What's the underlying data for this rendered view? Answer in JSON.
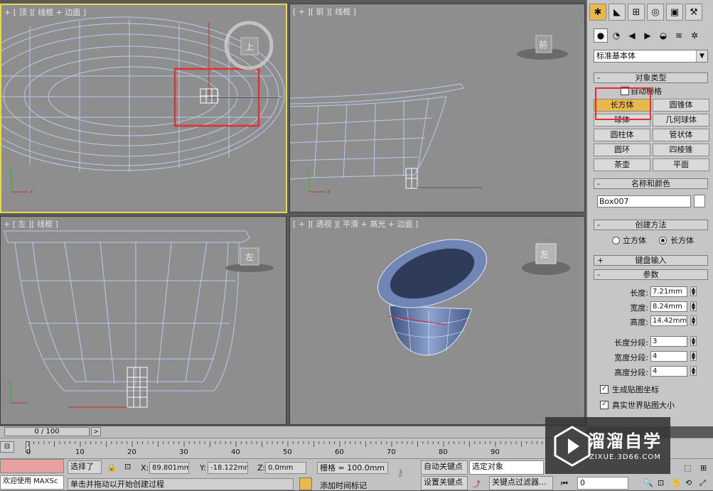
{
  "viewports": {
    "top": {
      "label": "+ [ 顶 ][ 线框 + 边面 ]",
      "cube_label": "上"
    },
    "front": {
      "label": "[ + ][ 前 ][ 线框 ]",
      "cube_label": "前"
    },
    "left": {
      "label": "+ [ 左 ][ 线框 ]",
      "cube_label": "左"
    },
    "persp": {
      "label": "[ + ][ 透视 ][ 平滑 + 高光 + 边面 ]",
      "cube_label": "左"
    }
  },
  "command_panel": {
    "category_dropdown": "标准基本体",
    "rollout_object_type": "对象类型",
    "auto_grid_label": "自动栅格",
    "object_buttons": [
      "长方体",
      "圆锥体",
      "球体",
      "几何球体",
      "圆柱体",
      "管状体",
      "圆环",
      "四棱锥",
      "茶壶",
      "平面"
    ],
    "selected_button": "长方体",
    "rollout_name_color": "名称和颜色",
    "object_name": "Box007",
    "rollout_creation": "创建方法",
    "creation_cube": "立方体",
    "creation_box": "长方体",
    "rollout_keyboard": "键盘输入",
    "rollout_params": "参数",
    "length_label": "长度:",
    "length_value": "7.21mm",
    "width_label": "宽度:",
    "width_value": "8.24mm",
    "height_label": "高度:",
    "height_value": "14.42mm",
    "length_segs_label": "长度分段:",
    "length_segs": "3",
    "width_segs_label": "宽度分段:",
    "width_segs": "4",
    "height_segs_label": "高度分段:",
    "height_segs": "4",
    "gen_map_coords": "生成贴图坐标",
    "real_world_map": "真实世界贴图大小"
  },
  "timeline": {
    "frame_display": "0 / 100",
    "next_arrow": ">",
    "ruler_ticks": [
      "0",
      "10",
      "20",
      "30",
      "40",
      "50",
      "60",
      "70",
      "80",
      "90"
    ]
  },
  "status": {
    "maxscript_label": "欢迎使用 MAXSc",
    "selected_label": "选择了",
    "prompt": "单击并拖动以开始创建过程",
    "x_label": "X:",
    "x_value": "89.801mm",
    "y_label": "Y:",
    "y_value": "-18.122mm",
    "z_label": "Z:",
    "z_value": "0.0mm",
    "grid": "栅格 = 100.0mm",
    "add_time_tag": "添加时间标记",
    "auto_key": "自动关键点",
    "set_key": "设置关键点",
    "selected_object": "选定对象",
    "key_filters": "关键点过滤器...",
    "frame_field": "0"
  },
  "watermark": {
    "title": "溜溜自学",
    "url": "ZIXUE.3D66.COM"
  },
  "colors": {
    "viewport_bg": "#8e8e8e",
    "wire": "#b8cbef",
    "active_border": "#e8d84a",
    "selection_highlight": "#e9b84d",
    "annotation_red": "#e53030"
  }
}
